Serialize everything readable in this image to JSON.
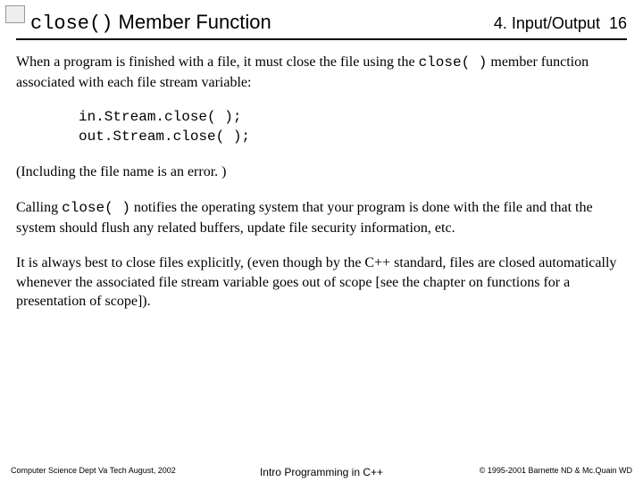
{
  "header": {
    "title_code": "close()",
    "title_rest": " Member Function",
    "chapter": "4. Input/Output",
    "page_num": "16"
  },
  "body": {
    "p1_a": "When a program is finished with a file, it must close the file using the ",
    "p1_code": "close( )",
    "p1_b": " member function associated with each file stream variable:",
    "code": "in.Stream.close( );\nout.Stream.close( );",
    "p2": "(Including the file name is an error. )",
    "p3_a": "Calling ",
    "p3_code": "close( )",
    "p3_b": " notifies the operating system that your program is done with the file and that the system should flush any related buffers, update file security information, etc.",
    "p4": "It is always best to close files explicitly, (even though by the C++ standard, files are closed automatically whenever the associated file stream variable goes out of scope [see the chapter on functions for a presentation of scope])."
  },
  "footer": {
    "left": "Computer Science Dept Va Tech  August, 2002",
    "center": "Intro Programming in C++",
    "right": "© 1995-2001  Barnette ND & Mc.Quain WD"
  }
}
